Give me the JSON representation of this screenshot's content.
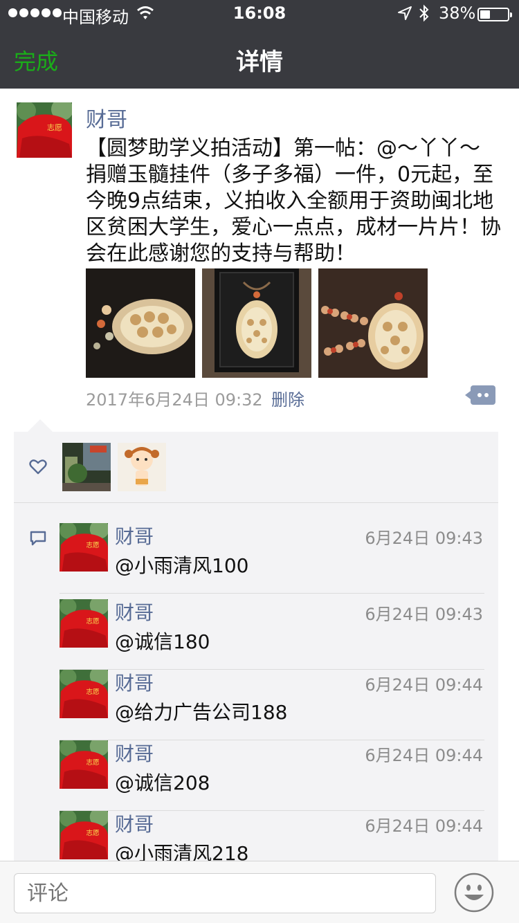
{
  "status_bar": {
    "carrier": "中国移动",
    "time": "16:08",
    "battery": "38%",
    "battery_level": 0.38
  },
  "nav": {
    "done_label": "完成",
    "title": "详情"
  },
  "post": {
    "author": "财哥",
    "text": "【圆梦助学义拍活动】第一帖：@～丫丫～ 捐赠玉髓挂件（多子多福）一件，0元起，至今晚9点结束，义拍收入全额用于资助闽北地区贫困大学生，爱心一点点，成材一片片！协会在此感谢您的支持与帮助！",
    "time": "2017年6月24日 09:32",
    "delete_label": "删除"
  },
  "comments": [
    {
      "name": "财哥",
      "time": "6月24日 09:43",
      "text": "@小雨清风100"
    },
    {
      "name": "财哥",
      "time": "6月24日 09:43",
      "text": "@诚信180"
    },
    {
      "name": "财哥",
      "time": "6月24日 09:44",
      "text": "@给力广告公司188"
    },
    {
      "name": "财哥",
      "time": "6月24日 09:44",
      "text": "@诚信208"
    },
    {
      "name": "财哥",
      "time": "6月24日 09:44",
      "text": "@小雨清风218"
    }
  ],
  "input": {
    "placeholder": "评论"
  },
  "colors": {
    "nav_bg": "#393a3f",
    "done_green": "#1aad19",
    "link_blue": "#576b95",
    "panel_bg": "#f3f3f5"
  }
}
